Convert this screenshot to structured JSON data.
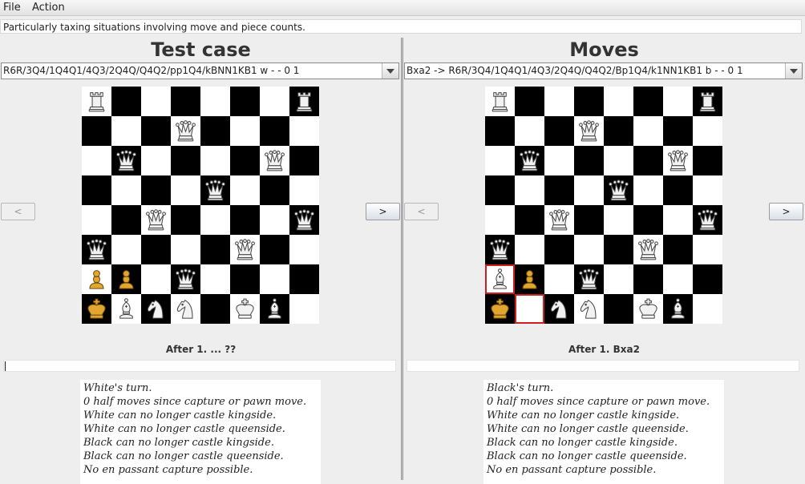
{
  "menu": {
    "file": "File",
    "action": "Action"
  },
  "description": "Particularly taxing situations involving move and piece counts.",
  "colors": {
    "highlight": "#cc1f1f",
    "dark_square": "#000000",
    "light_square": "#ffffff"
  },
  "left": {
    "title": "Test case",
    "combo": "R6R/3Q4/1Q4Q1/4Q3/2Q4Q/Q4Q2/pp1Q4/kBNN1KB1 w - - 0 1",
    "board": [
      [
        "R",
        "",
        "",
        "",
        "",
        "",
        "",
        "R"
      ],
      [
        "",
        "",
        "",
        "Q",
        "",
        "",
        "",
        ""
      ],
      [
        "",
        "Q",
        "",
        "",
        "",
        "",
        "Q",
        ""
      ],
      [
        "",
        "",
        "",
        "",
        "Q",
        "",
        "",
        ""
      ],
      [
        "",
        "",
        "Q",
        "",
        "",
        "",
        "",
        "Q"
      ],
      [
        "Q",
        "",
        "",
        "",
        "",
        "Q",
        "",
        ""
      ],
      [
        "p",
        "p",
        "",
        "Q",
        "",
        "",
        "",
        ""
      ],
      [
        "k",
        "B",
        "N",
        "N",
        "",
        "K",
        "B",
        ""
      ]
    ],
    "prev": "<",
    "next": ">",
    "after": "After 1. ... ??",
    "status": [
      "White's turn.",
      "0 half moves since capture or pawn move.",
      "White can no longer castle kingside.",
      "White can no longer castle queenside.",
      "Black can no longer castle kingside.",
      "Black can no longer castle queenside.",
      "No en passant capture possible."
    ]
  },
  "right": {
    "title": "Moves",
    "combo": "Bxa2 -> R6R/3Q4/1Q4Q1/4Q3/2Q4Q/Q4Q2/Bp1Q4/k1NN1KB1 b - - 0 1",
    "board": [
      [
        "R",
        "",
        "",
        "",
        "",
        "",
        "",
        "R"
      ],
      [
        "",
        "",
        "",
        "Q",
        "",
        "",
        "",
        ""
      ],
      [
        "",
        "Q",
        "",
        "",
        "",
        "",
        "Q",
        ""
      ],
      [
        "",
        "",
        "",
        "",
        "Q",
        "",
        "",
        ""
      ],
      [
        "",
        "",
        "Q",
        "",
        "",
        "",
        "",
        "Q"
      ],
      [
        "Q",
        "",
        "",
        "",
        "",
        "Q",
        "",
        ""
      ],
      [
        "B",
        "p",
        "",
        "Q",
        "",
        "",
        "",
        ""
      ],
      [
        "k",
        "",
        "N",
        "N",
        "",
        "K",
        "B",
        ""
      ]
    ],
    "highlight": [
      [
        6,
        0
      ],
      [
        7,
        1
      ]
    ],
    "prev": "<",
    "next": ">",
    "after": "After 1. Bxa2",
    "status": [
      "Black's turn.",
      "0 half moves since capture or pawn move.",
      "White can no longer castle kingside.",
      "White can no longer castle queenside.",
      "Black can no longer castle kingside.",
      "Black can no longer castle queenside.",
      "No en passant capture possible."
    ]
  }
}
